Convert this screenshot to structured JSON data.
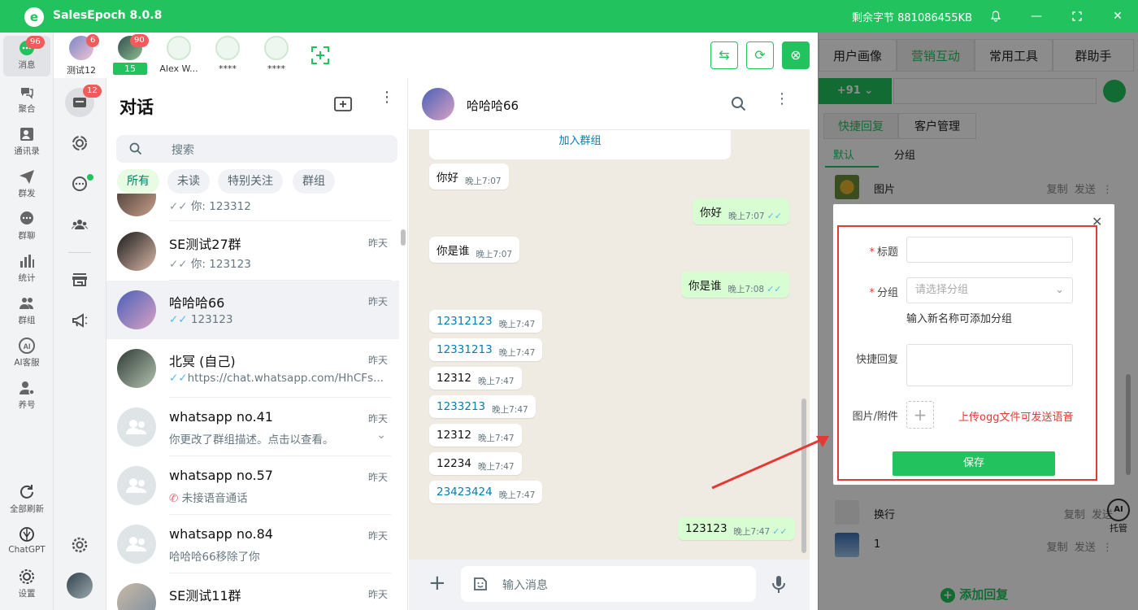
{
  "app": {
    "title": "SalesEpoch 8.0.8",
    "logo_letter": "e",
    "bytes_label": "剩余字节 881086455KB"
  },
  "rail": {
    "items": [
      {
        "label": "消息",
        "badge": "96"
      },
      {
        "label": "聚合"
      },
      {
        "label": "通讯录"
      },
      {
        "label": "群发"
      },
      {
        "label": "群聊"
      },
      {
        "label": "统计"
      },
      {
        "label": "群组"
      },
      {
        "label": "AI客服"
      },
      {
        "label": "养号"
      }
    ],
    "bottom": [
      {
        "label": "全部刷新"
      },
      {
        "label": "ChatGPT"
      },
      {
        "label": "设置"
      }
    ]
  },
  "accounts": [
    {
      "name": "测试12",
      "badge": "6"
    },
    {
      "name": "15",
      "badge": "90"
    },
    {
      "name": "Alex W..."
    },
    {
      "name": "****"
    },
    {
      "name": "****"
    }
  ],
  "iconcol": {
    "badge": "12"
  },
  "chatlist": {
    "title": "对话",
    "search_placeholder": "搜索",
    "filters": [
      "所有",
      "未读",
      "特别关注",
      "群组"
    ],
    "partial": {
      "msg": "你: 123312"
    },
    "chats": [
      {
        "name": "SE测试27群",
        "msg": "你: 123123",
        "time": "昨天"
      },
      {
        "name": "哈哈哈66",
        "msg": "123123",
        "time": "昨天"
      },
      {
        "name": "北冥 (自己)",
        "msg": "https://chat.whatsapp.com/HhCFs...",
        "time": "昨天"
      },
      {
        "name": "whatsapp no.41",
        "msg": "你更改了群组描述。点击以查看。",
        "time": "昨天"
      },
      {
        "name": "whatsapp no.57",
        "msg": "未接语音通话",
        "time": "昨天"
      },
      {
        "name": "whatsapp no.84",
        "msg": "哈哈哈66移除了你",
        "time": "昨天"
      },
      {
        "name": "SE测试11群",
        "msg": "",
        "time": "昨天"
      }
    ]
  },
  "chat": {
    "contact": "哈哈哈66",
    "join_group": "加入群组",
    "messages": [
      {
        "text": "你好",
        "time": "晚上7:07",
        "dir": "in"
      },
      {
        "text": "你好",
        "time": "晚上7:07",
        "dir": "out"
      },
      {
        "text": "你是谁",
        "time": "晚上7:07",
        "dir": "in"
      },
      {
        "text": "你是谁",
        "time": "晚上7:08",
        "dir": "out"
      },
      {
        "text": "12312123",
        "time": "晚上7:47",
        "dir": "in",
        "link": true
      },
      {
        "text": "12331213",
        "time": "晚上7:47",
        "dir": "in",
        "link": true
      },
      {
        "text": "12312",
        "time": "晚上7:47",
        "dir": "in"
      },
      {
        "text": "1233213",
        "time": "晚上7:47",
        "dir": "in",
        "link": true
      },
      {
        "text": "12312",
        "time": "晚上7:47",
        "dir": "in"
      },
      {
        "text": "12234",
        "time": "晚上7:47",
        "dir": "in"
      },
      {
        "text": "23423424",
        "time": "晚上7:47",
        "dir": "in",
        "link": true
      },
      {
        "text": "123123",
        "time": "晚上7:47",
        "dir": "out"
      }
    ],
    "composer_placeholder": "输入消息"
  },
  "right": {
    "tabs": [
      "用户画像",
      "营销互动",
      "常用工具",
      "群助手"
    ],
    "country_code": "+91",
    "subtabs": [
      "快捷回复",
      "客户管理"
    ],
    "groups": [
      "默认",
      "分组"
    ],
    "rows": [
      {
        "label": "图片",
        "copy": "复制",
        "send": "发送"
      },
      {
        "label": "换行",
        "copy": "复制",
        "send": "发送"
      },
      {
        "label": "1",
        "copy": "复制",
        "send": "发送"
      }
    ],
    "add_reply": "添加回复",
    "ai_host": "托管"
  },
  "dialog": {
    "title_label": "标题",
    "group_label": "分组",
    "group_placeholder": "请选择分组",
    "group_hint": "输入新名称可添加分组",
    "reply_label": "快捷回复",
    "attach_label": "图片/附件",
    "upload_hint": "上传ogg文件可发送语音",
    "save": "保存"
  },
  "colors": {
    "brand": "#22c35e",
    "badge": "#f15b5b",
    "annotation": "#e53935"
  }
}
